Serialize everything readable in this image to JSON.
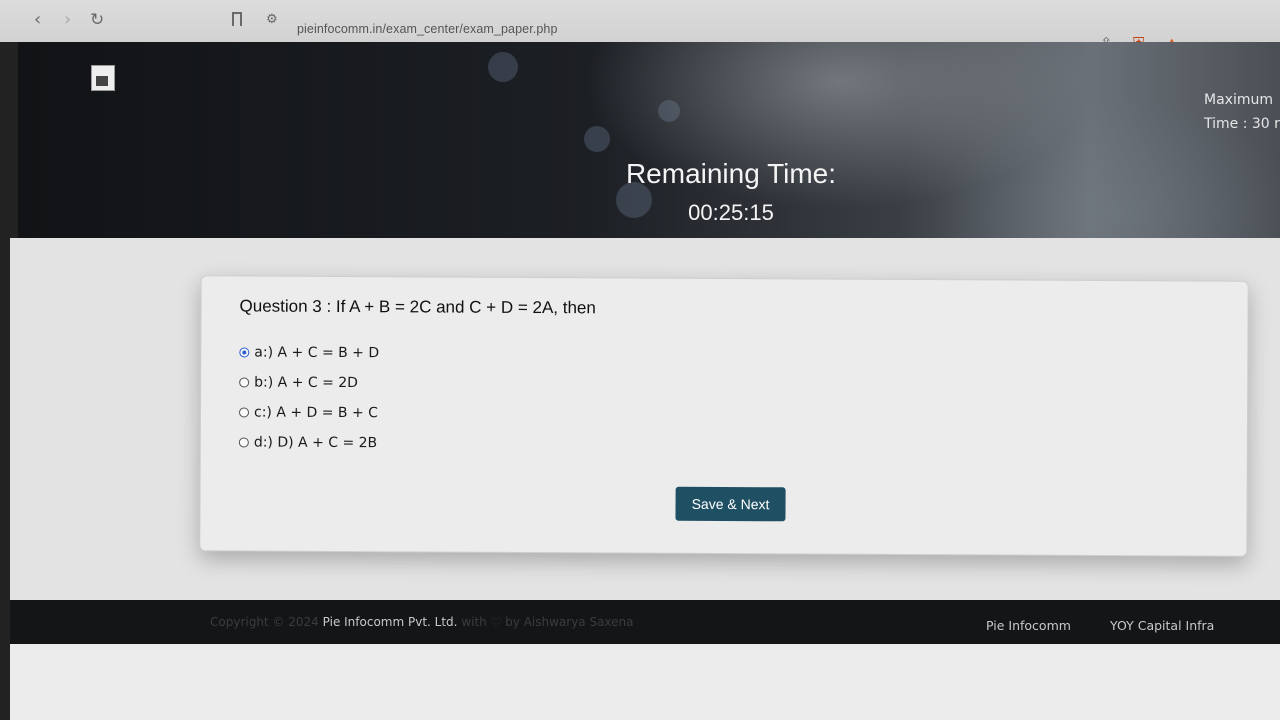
{
  "browser": {
    "url": "pieinfocomm.in/exam_center/exam_paper.php",
    "icons": [
      "back-icon",
      "forward-icon",
      "reload-icon",
      "bookmark-icon",
      "site-info-icon",
      "share-icon",
      "shield-extension-icon",
      "badge-extension-icon"
    ]
  },
  "header": {
    "exam_info_line1": "Maximum",
    "exam_info_line2": "Time : 30 r",
    "remaining_label": "Remaining Time:",
    "remaining_time": "00:25:15"
  },
  "question": {
    "text": "Question 3 : If A + B = 2C and C + D = 2A, then",
    "options": [
      {
        "label": "a:) A + C = B + D",
        "selected": true
      },
      {
        "label": "b:) A + C = 2D",
        "selected": false
      },
      {
        "label": "c:) A + D = B + C",
        "selected": false
      },
      {
        "label": "d:) D) A + C = 2B",
        "selected": false
      }
    ],
    "save_next_label": "Save & Next"
  },
  "footer": {
    "copyright_prefix": "Copyright © 2024",
    "company": "Pie Infocomm Pvt. Ltd.",
    "credit": "with ♡ by Aishwarya Saxena",
    "links": [
      "Pie Infocomm",
      "YOY Capital Infra"
    ]
  },
  "colors": {
    "button_bg": "#1f4f63",
    "radio_selected": "#2d5bd3",
    "footer_bg": "#141517"
  }
}
